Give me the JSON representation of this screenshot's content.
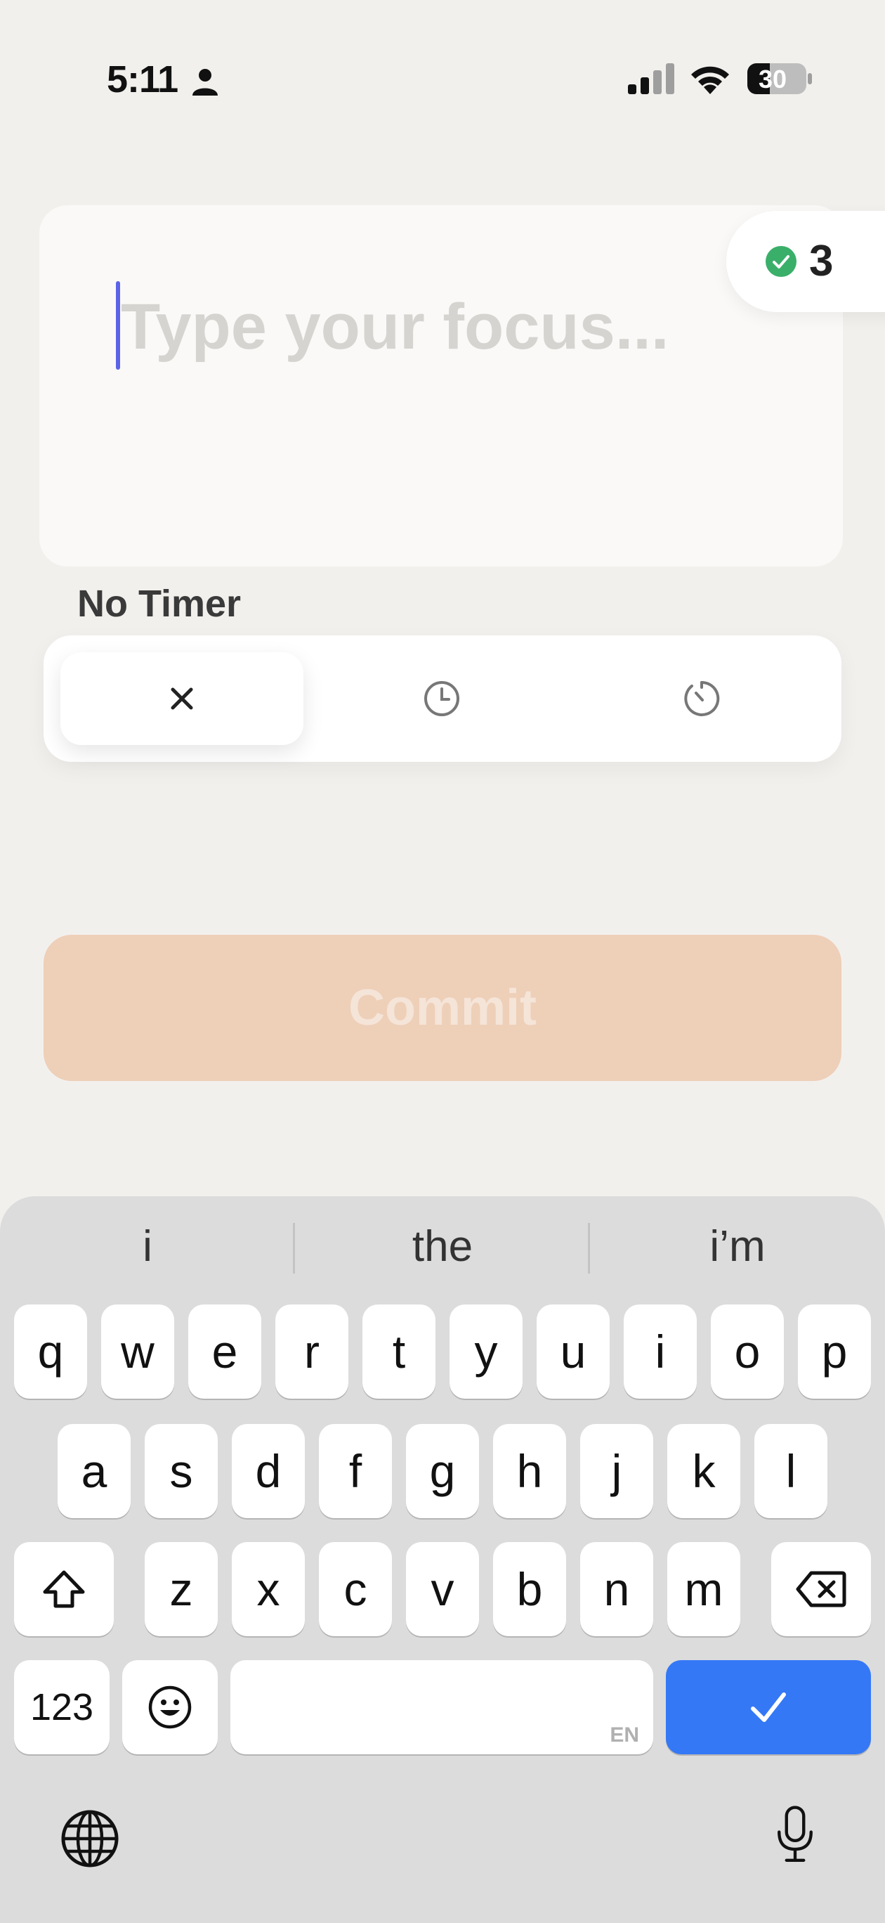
{
  "status_bar": {
    "time": "5:11",
    "battery": "30"
  },
  "focus": {
    "placeholder": "Type your focus...",
    "value": ""
  },
  "badge": {
    "count": "3"
  },
  "timer": {
    "label": "No Timer",
    "options": [
      "no-timer",
      "clock",
      "timer"
    ],
    "selected": 0
  },
  "commit": {
    "label": "Commit"
  },
  "keyboard": {
    "suggestions": [
      "i",
      "the",
      "i’m"
    ],
    "row1": [
      "q",
      "w",
      "e",
      "r",
      "t",
      "y",
      "u",
      "i",
      "o",
      "p"
    ],
    "row2": [
      "a",
      "s",
      "d",
      "f",
      "g",
      "h",
      "j",
      "k",
      "l"
    ],
    "row3": [
      "z",
      "x",
      "c",
      "v",
      "b",
      "n",
      "m"
    ],
    "numbers_key": "123",
    "space_lang": "EN"
  },
  "colors": {
    "accent": "#3478f6",
    "commit_bg": "#eecfb8",
    "check": "#3aaf6a",
    "caret": "#5b63e8"
  }
}
